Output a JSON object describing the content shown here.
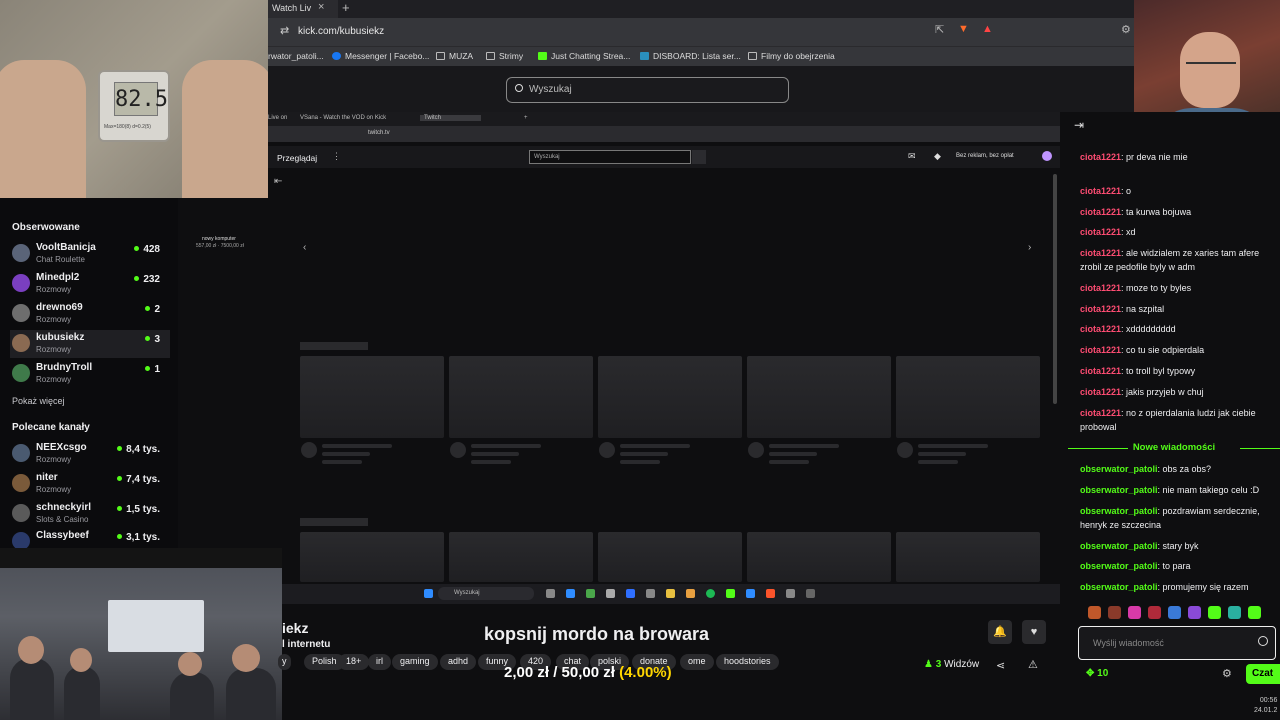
{
  "browser": {
    "tab_title": "Watch Liv",
    "url": "kick.com/kubusiekz",
    "bookmarks": [
      "rwator_patoli...",
      "Messenger | Facebo...",
      "MUZA",
      "Strimy",
      "Just Chatting Strea...",
      "DISBOARD: Lista ser...",
      "Filmy do obejrzenia"
    ]
  },
  "kick": {
    "search_placeholder": "Wyszukaj"
  },
  "scale": {
    "reading": "82.5",
    "caption": "Max=180(8) d=0.2(5)"
  },
  "sidebar": {
    "followed_heading": "Obserwowane",
    "followed": [
      {
        "name": "VooltBanicja",
        "category": "Chat Roulette",
        "viewers": "428",
        "avatar": "#5a6478"
      },
      {
        "name": "Minedpl2",
        "category": "Rozmowy",
        "viewers": "232",
        "avatar": "#7a3fc0"
      },
      {
        "name": "drewno69",
        "category": "Rozmowy",
        "viewers": "2",
        "avatar": "#6e6e6e"
      },
      {
        "name": "kubusiekz",
        "category": "Rozmowy",
        "viewers": "3",
        "avatar": "#8a6a52"
      },
      {
        "name": "BrudnyTroll",
        "category": "Rozmowy",
        "viewers": "1",
        "avatar": "#3f7a4a"
      }
    ],
    "show_more": "Pokaż więcej",
    "recommended_heading": "Polecane kanały",
    "recommended": [
      {
        "name": "NEEXcsgo",
        "category": "Rozmowy",
        "viewers": "8,4 tys.",
        "avatar": "#4a5a70"
      },
      {
        "name": "niter",
        "category": "Rozmowy",
        "viewers": "7,4 tys.",
        "avatar": "#7a5a3a"
      },
      {
        "name": "schneckyirl",
        "category": "Slots & Casino",
        "viewers": "1,5 tys.",
        "avatar": "#5a5a5a"
      },
      {
        "name": "Classybeef",
        "category": "",
        "viewers": "3,1 tys.",
        "avatar": "#2a3a6a"
      }
    ]
  },
  "twitch": {
    "tabs": [
      "Live on",
      "VSana - Watch the VOD on Kick",
      "Twitch"
    ],
    "url": "twitch.tv",
    "browse": "Przeglądaj",
    "search": "Wyszukaj",
    "ads": "Bez reklam, bez opłat",
    "promo": "nowy komputer",
    "promo_amount": "557,00 zł · 7500,00 zł"
  },
  "stream": {
    "channel_partial": "iekz",
    "category_partial": "l internetu",
    "title": "kopsnij mordo na browara",
    "tags": [
      "y",
      "Polish",
      "18+",
      "irl",
      "gaming",
      "adhd",
      "funny",
      "420",
      "chat",
      "polski",
      "donate",
      "ome",
      "hoodstories"
    ],
    "goal_current": "2,00 zł",
    "goal_sep": "/",
    "goal_target": "50,00 zł",
    "goal_pct": "(4.00%)",
    "goal_fraction": 0.04,
    "viewers": "3",
    "viewers_label": "Widzów"
  },
  "chat": {
    "messages": [
      {
        "user": "ciota1221",
        "text": "pr deva nie mie"
      },
      {
        "user": "ciota1221",
        "text": "o"
      },
      {
        "user": "ciota1221",
        "text": "ta kurwa bojuwa"
      },
      {
        "user": "ciota1221",
        "text": "xd"
      },
      {
        "user": "ciota1221",
        "text": "ale widzialem ze xaries tam afere zrobil ze pedofile byly w adm"
      },
      {
        "user": "ciota1221",
        "text": "moze to ty byles"
      },
      {
        "user": "ciota1221",
        "text": "na szpital"
      },
      {
        "user": "ciota1221",
        "text": "xddddddddd"
      },
      {
        "user": "ciota1221",
        "text": "co tu sie odpierdala"
      },
      {
        "user": "ciota1221",
        "text": "to troll byl typowy"
      },
      {
        "user": "ciota1221",
        "text": "jakis przyjeb w chuj"
      },
      {
        "user": "ciota1221",
        "text": "no z opierdalania ludzi jak ciebie probowal"
      }
    ],
    "new_messages_label": "Nowe wiadomości",
    "new_messages": [
      {
        "user": "obserwator_patoli",
        "text": "obs za obs?"
      },
      {
        "user": "obserwator_patoli",
        "text": "nie mam takiego celu :D"
      },
      {
        "user": "obserwator_patoli",
        "text": "pozdrawiam serdecznie, henryk ze szczecina"
      },
      {
        "user": "obserwator_patoli",
        "text": "stary byk"
      },
      {
        "user": "obserwator_patoli",
        "text": "to para"
      },
      {
        "user": "obserwator_patoli",
        "text": "promujemy się razem"
      }
    ],
    "input_placeholder": "Wyślij wiadomość",
    "points": "10",
    "send_label": "Czat"
  },
  "clock": {
    "time": "00:56",
    "date": "24.01.2"
  },
  "colors": {
    "kick_green": "#53fc18",
    "chat_user_red": "#ff4d73",
    "goal_yellow": "#ffd600",
    "twitch_purple": "#9146ff"
  }
}
